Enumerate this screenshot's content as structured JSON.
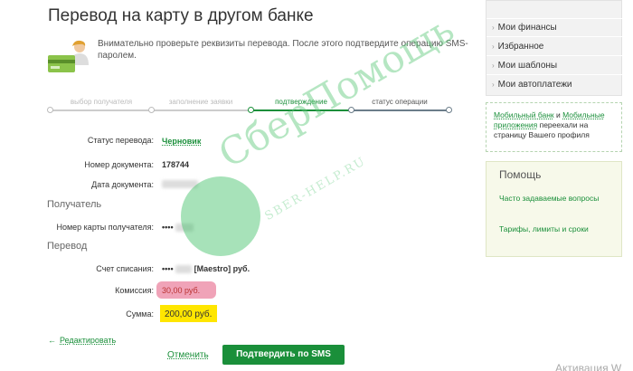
{
  "page": {
    "title": "Перевод на карту в другом банке",
    "intro_text": "Внимательно проверьте реквизиты перевода. После этого подтвердите операцию SMS-паролем."
  },
  "steps": [
    {
      "label": "выбор получателя",
      "state": "done"
    },
    {
      "label": "заполнение заявки",
      "state": "done"
    },
    {
      "label": "подтверждение",
      "state": "active"
    },
    {
      "label": "статус операции",
      "state": "future"
    }
  ],
  "details": {
    "status_label": "Статус перевода:",
    "status_value": "Черновик",
    "doc_number_label": "Номер документа:",
    "doc_number_value": "178744",
    "doc_date_label": "Дата документа:"
  },
  "recipient": {
    "section_title": "Получатель",
    "card_label": "Номер карты получателя:",
    "card_value": "••••"
  },
  "transfer": {
    "section_title": "Перевод",
    "account_label": "Счет списания:",
    "account_prefix": "••••",
    "account_type": "[Maestro]",
    "account_suffix": "руб.",
    "commission_label": "Комиссия:",
    "commission_value": "30,00 руб.",
    "sum_label": "Сумма:",
    "sum_value": "200,00  руб."
  },
  "actions": {
    "edit_label": "Редактировать",
    "cancel_label": "Отменить",
    "confirm_label": "Подтвердить по SMS"
  },
  "watermark": {
    "title": "СберПомощь",
    "subtitle": "SBER-HELP.RU"
  },
  "sidebar": {
    "menu": [
      "Мои финансы",
      "Избранное",
      "Мои шаблоны",
      "Мои автоплатежи"
    ],
    "notice_link1": "Мобильный банк",
    "notice_and": " и ",
    "notice_link2": "Мобильные приложения",
    "notice_rest": " переехали на страницу Вашего профиля",
    "help_title": "Помощь",
    "help_link1": "Часто задаваемые вопросы",
    "help_link2": "Тарифы, лимиты и сроки"
  },
  "os": {
    "activation_text": "Активация W"
  },
  "colors": {
    "accent_green": "#1a8f3a",
    "commission_highlight": "#f0a3b8",
    "sum_highlight": "#ffe600"
  }
}
